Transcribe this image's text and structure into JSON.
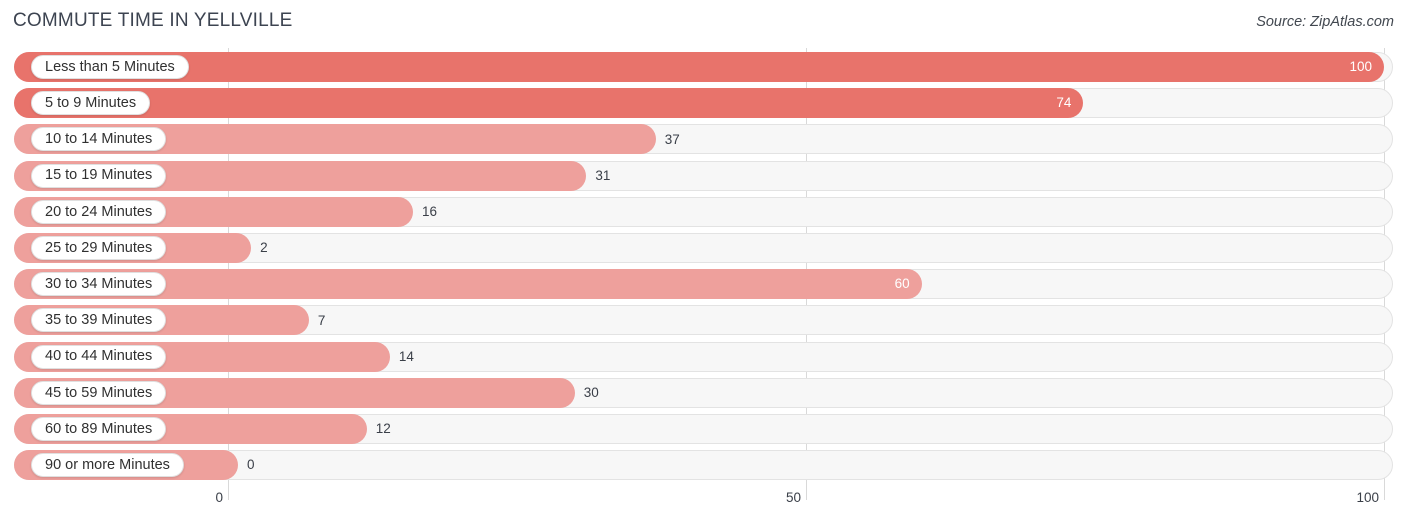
{
  "header": {
    "title": "COMMUTE TIME IN YELLVILLE",
    "source": "Source: ZipAtlas.com"
  },
  "colors": {
    "bar_dark": "#e8736b",
    "bar_light": "#eea09c",
    "track": "#f7f7f7",
    "track_border": "#e3e3e3",
    "grid": "#d9d9d9",
    "label_text": "#303030",
    "value_text_inside": "#ffffff",
    "value_text_outside": "#3a3f48",
    "title_text": "#3d4451"
  },
  "chart_data": {
    "type": "bar",
    "orientation": "horizontal",
    "title": "COMMUTE TIME IN YELLVILLE",
    "xlabel": "",
    "ylabel": "",
    "xlim": [
      0,
      100
    ],
    "xticks": [
      "0",
      "50",
      "100"
    ],
    "xtick_values": [
      0,
      50,
      100
    ],
    "grid": true,
    "legend": "none",
    "categories": [
      "Less than 5 Minutes",
      "5 to 9 Minutes",
      "10 to 14 Minutes",
      "15 to 19 Minutes",
      "20 to 24 Minutes",
      "25 to 29 Minutes",
      "30 to 34 Minutes",
      "35 to 39 Minutes",
      "40 to 44 Minutes",
      "45 to 59 Minutes",
      "60 to 89 Minutes",
      "90 or more Minutes"
    ],
    "values": [
      100,
      74,
      37,
      31,
      16,
      2,
      60,
      7,
      14,
      30,
      12,
      0
    ],
    "value_labels": [
      "100",
      "74",
      "37",
      "31",
      "16",
      "2",
      "60",
      "7",
      "14",
      "30",
      "12",
      "0"
    ]
  },
  "rows": [
    {
      "label": "Less than 5 Minutes",
      "value": 100,
      "value_label": "100",
      "shade": "dark",
      "label_inside": true
    },
    {
      "label": "5 to 9 Minutes",
      "value": 74,
      "value_label": "74",
      "shade": "dark",
      "label_inside": true
    },
    {
      "label": "10 to 14 Minutes",
      "value": 37,
      "value_label": "37",
      "shade": "light",
      "label_inside": false
    },
    {
      "label": "15 to 19 Minutes",
      "value": 31,
      "value_label": "31",
      "shade": "light",
      "label_inside": false
    },
    {
      "label": "20 to 24 Minutes",
      "value": 16,
      "value_label": "16",
      "shade": "light",
      "label_inside": false
    },
    {
      "label": "25 to 29 Minutes",
      "value": 2,
      "value_label": "2",
      "shade": "light",
      "label_inside": false
    },
    {
      "label": "30 to 34 Minutes",
      "value": 60,
      "value_label": "60",
      "shade": "light",
      "label_inside": true
    },
    {
      "label": "35 to 39 Minutes",
      "value": 7,
      "value_label": "7",
      "shade": "light",
      "label_inside": false
    },
    {
      "label": "40 to 44 Minutes",
      "value": 14,
      "value_label": "14",
      "shade": "light",
      "label_inside": false
    },
    {
      "label": "45 to 59 Minutes",
      "value": 30,
      "value_label": "30",
      "shade": "light",
      "label_inside": false
    },
    {
      "label": "60 to 89 Minutes",
      "value": 12,
      "value_label": "12",
      "shade": "light",
      "label_inside": false
    },
    {
      "label": "90 or more Minutes",
      "value": 0,
      "value_label": "0",
      "shade": "light",
      "label_inside": false
    }
  ]
}
